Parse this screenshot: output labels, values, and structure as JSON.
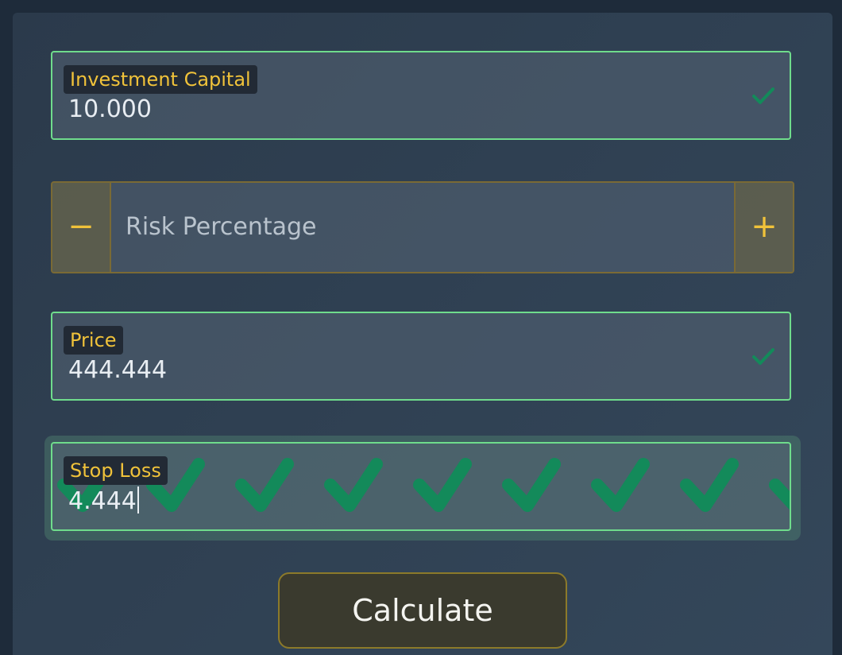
{
  "form": {
    "investment": {
      "label": "Investment Capital",
      "value": "10.000",
      "valid": true
    },
    "risk": {
      "placeholder": "Risk Percentage",
      "minus": "−",
      "plus": "+"
    },
    "price": {
      "label": "Price",
      "value": "444.444",
      "valid": true
    },
    "stop_loss": {
      "label": "Stop Loss",
      "value": "4.444",
      "valid": true,
      "focused": true
    },
    "calculate_label": "Calculate"
  },
  "colors": {
    "accent": "#f0c23a",
    "valid": "#6fdc8c",
    "check": "#138a5a",
    "background": "#2f4052"
  },
  "icons": [
    "check-icon",
    "minus-icon",
    "plus-icon"
  ]
}
